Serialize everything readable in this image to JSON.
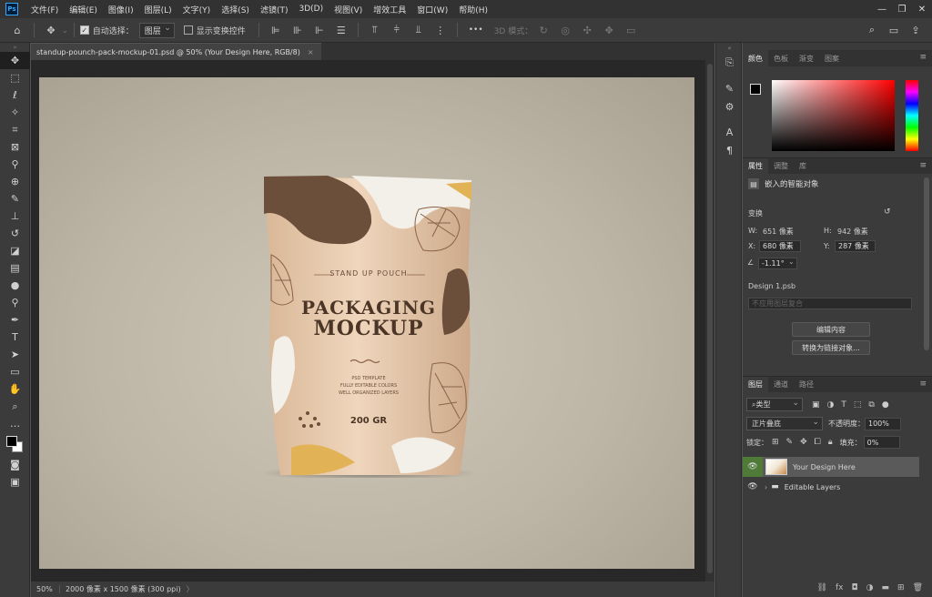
{
  "app": {
    "logo": "Ps"
  },
  "menu": [
    "文件(F)",
    "编辑(E)",
    "图像(I)",
    "图层(L)",
    "文字(Y)",
    "选择(S)",
    "滤镜(T)",
    "3D(D)",
    "视图(V)",
    "增效工具",
    "窗口(W)",
    "帮助(H)"
  ],
  "window_controls": {
    "minimize": "—",
    "restore": "❐",
    "close": "✕"
  },
  "options": {
    "auto_select_label": "自动选择：",
    "auto_select_target": "图层",
    "show_transform_label": "显示变换控件",
    "mode_3d_label": "3D 模式：",
    "more": "•••"
  },
  "document": {
    "tab_title": "standup-pounch-pack-mockup-01.psd @ 50% (Your Design Here, RGB/8)",
    "tab_close": "×",
    "zoom": "50%",
    "info": "2000 像素 x 1500 像素 (300 ppi)",
    "info_arrow": "〉"
  },
  "pouch": {
    "top_label": "STAND UP POUCH",
    "title_line1": "PACKAGING",
    "title_line2": "MOCKUP",
    "features": [
      "PSD TEMPLATE",
      "FULLY EDITABLE COLORS",
      "WELL ORGANIZED LAYERS"
    ],
    "weight": "200 GR"
  },
  "color_panel": {
    "tabs": [
      "颜色",
      "色板",
      "渐变",
      "图案"
    ],
    "menu": "≡"
  },
  "properties": {
    "tabs": [
      "属性",
      "调整",
      "库"
    ],
    "type_label": "嵌入的智能对象",
    "transform_label": "变换",
    "w_label": "W:",
    "w_value": "651 像素",
    "h_label": "H:",
    "h_value": "942 像素",
    "x_label": "X:",
    "x_value": "680 像素",
    "y_label": "Y:",
    "y_value": "287 像素",
    "angle_value": "-1.11°",
    "file_name": "Design 1.psb",
    "comp_placeholder": "不应用图层复合",
    "edit_button": "编辑内容",
    "convert_button": "转换为链接对象..."
  },
  "layers": {
    "tabs": [
      "图层",
      "通道",
      "路径"
    ],
    "filter_kind": "类型",
    "blend_mode": "正片叠底",
    "opacity_label": "不透明度：",
    "opacity_value": "100%",
    "lock_label": "锁定：",
    "fill_label": "填充：",
    "fill_value": "0%",
    "items": [
      {
        "name": "Your Design Here",
        "selected": true
      },
      {
        "name": "Editable Layers",
        "selected": false
      }
    ],
    "footer_icons": [
      "link-icon",
      "fx-icon",
      "mask-icon",
      "adjustment-icon",
      "group-icon",
      "new-layer-icon",
      "delete-icon"
    ]
  }
}
